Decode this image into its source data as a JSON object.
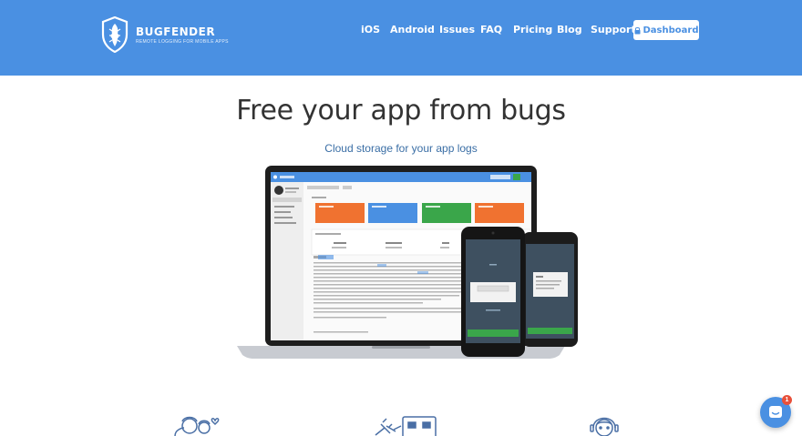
{
  "brand": {
    "name": "BUGFENDER",
    "tagline": "REMOTE LOGGING FOR MOBILE APPS"
  },
  "nav": {
    "items": [
      {
        "label": "iOS"
      },
      {
        "label": "Android"
      },
      {
        "label": "Issues"
      },
      {
        "label": "FAQ"
      },
      {
        "label": "Pricing"
      },
      {
        "label": "Blog"
      },
      {
        "label": "Support"
      }
    ],
    "dashboard_label": "Dashboard"
  },
  "hero": {
    "title": "Free your app from bugs",
    "subtitle": "Cloud storage for your app logs"
  },
  "chat": {
    "badge_count": "1"
  },
  "colors": {
    "brand_blue": "#4a90e2",
    "card_orange": "#f07230",
    "card_blue": "#4a90e2",
    "card_green": "#3aa64a",
    "badge_red": "#e8503a"
  },
  "icons": [
    "shield-logo-icon",
    "lock-icon",
    "chat-icon",
    "people-heart-icon",
    "plug-device-icon",
    "support-agent-icon"
  ]
}
